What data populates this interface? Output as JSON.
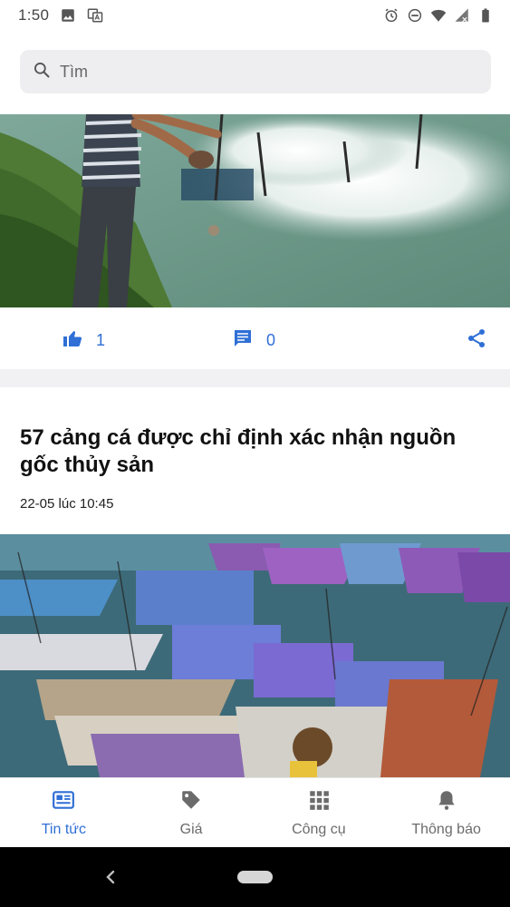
{
  "status_bar": {
    "time": "1:50",
    "left_icons": [
      "image-icon",
      "translate-icon"
    ],
    "right_icons": [
      "alarm-icon",
      "do-not-disturb-icon",
      "wifi-icon",
      "signal-icon",
      "battery-icon"
    ]
  },
  "search": {
    "placeholder": "Tìm",
    "icon": "search-icon"
  },
  "post": {
    "likes": "1",
    "comments": "0",
    "like_icon": "thumbs-up-icon",
    "comment_icon": "comment-icon",
    "share_icon": "share-icon"
  },
  "article": {
    "title": "57 cảng cá được chỉ định xác nhận nguồn gốc thủy sản",
    "timestamp": "22-05 lúc 10:45"
  },
  "bottom_nav": {
    "items": [
      {
        "label": "Tin tức",
        "icon": "newspaper-icon",
        "active": true
      },
      {
        "label": "Giá",
        "icon": "price-tag-icon",
        "active": false
      },
      {
        "label": "Công cụ",
        "icon": "grid-icon",
        "active": false
      },
      {
        "label": "Thông báo",
        "icon": "bell-icon",
        "active": false
      }
    ]
  },
  "colors": {
    "accent": "#2f6fd6",
    "inactive": "#6b6b6b",
    "search_bg": "#eeeef0"
  }
}
